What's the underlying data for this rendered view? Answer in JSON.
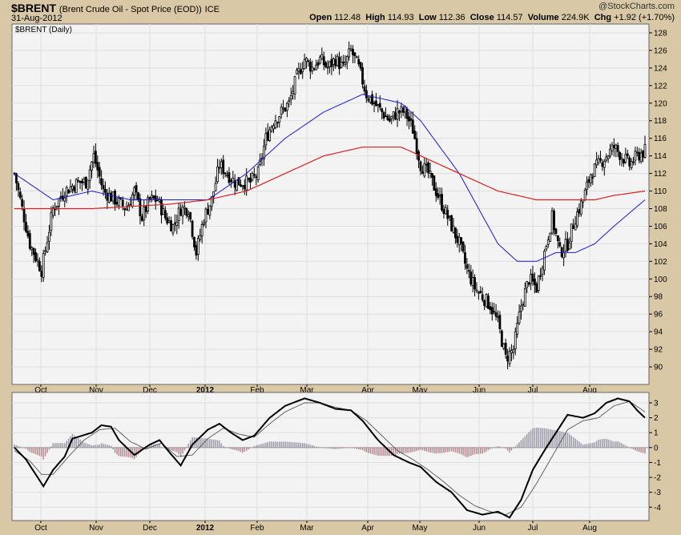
{
  "header": {
    "symbol": "$BRENT",
    "description": "(Brent Crude Oil - Spot Price (EOD))",
    "exchange": "ICE",
    "date": "31-Aug-2012",
    "watermark": "@StockCharts.com",
    "quote": {
      "open_label": "Open",
      "open": "112.48",
      "high_label": "High",
      "high": "114.93",
      "low_label": "Low",
      "low": "112.36",
      "close_label": "Close",
      "close": "114.57",
      "volume_label": "Volume",
      "volume": "224.9K",
      "chg_label": "Chg",
      "chg": "+1.92 (+1.70%)"
    }
  },
  "chart_data": [
    {
      "type": "candlestick",
      "legend": "$BRENT (Daily)",
      "ylim": [
        88,
        129
      ],
      "yticks": [
        90,
        92,
        94,
        96,
        98,
        100,
        102,
        104,
        106,
        108,
        110,
        112,
        114,
        116,
        118,
        120,
        122,
        124,
        126,
        128
      ],
      "grid": true,
      "x_labels": [
        "Oct",
        "Nov",
        "Dec",
        "2012",
        "Feb",
        "Mar",
        "Apr",
        "May",
        "Jun",
        "Jul",
        "Aug"
      ],
      "price_anchors": [
        [
          0,
          112
        ],
        [
          8,
          104
        ],
        [
          14,
          101
        ],
        [
          20,
          108
        ],
        [
          26,
          110
        ],
        [
          33,
          111
        ],
        [
          37,
          111
        ],
        [
          41,
          114
        ],
        [
          46,
          110
        ],
        [
          52,
          109
        ],
        [
          58,
          108
        ],
        [
          62,
          110
        ],
        [
          66,
          107
        ],
        [
          70,
          109
        ],
        [
          74,
          109
        ],
        [
          78,
          107
        ],
        [
          82,
          106
        ],
        [
          86,
          108
        ],
        [
          90,
          108
        ],
        [
          94,
          103
        ],
        [
          98,
          107
        ],
        [
          102,
          109
        ],
        [
          106,
          113
        ],
        [
          110,
          112
        ],
        [
          114,
          111
        ],
        [
          118,
          111
        ],
        [
          122,
          111
        ],
        [
          126,
          112
        ],
        [
          130,
          116
        ],
        [
          134,
          118
        ],
        [
          138,
          119
        ],
        [
          142,
          120
        ],
        [
          146,
          123
        ],
        [
          150,
          125
        ],
        [
          154,
          124
        ],
        [
          158,
          125
        ],
        [
          162,
          124
        ],
        [
          166,
          125
        ],
        [
          170,
          124
        ],
        [
          174,
          126
        ],
        [
          178,
          124
        ],
        [
          182,
          121
        ],
        [
          186,
          120
        ],
        [
          190,
          119
        ],
        [
          194,
          118
        ],
        [
          198,
          119
        ],
        [
          202,
          119
        ],
        [
          206,
          117
        ],
        [
          210,
          113
        ],
        [
          214,
          112
        ],
        [
          218,
          110
        ],
        [
          222,
          108
        ],
        [
          226,
          106
        ],
        [
          230,
          104
        ],
        [
          234,
          101
        ],
        [
          238,
          99
        ],
        [
          242,
          98
        ],
        [
          246,
          97
        ],
        [
          250,
          95
        ],
        [
          254,
          91
        ],
        [
          258,
          92
        ],
        [
          262,
          97
        ],
        [
          266,
          100
        ],
        [
          270,
          99
        ],
        [
          274,
          103
        ],
        [
          278,
          107
        ],
        [
          282,
          103
        ],
        [
          286,
          104
        ],
        [
          290,
          107
        ],
        [
          294,
          109
        ],
        [
          298,
          112
        ],
        [
          302,
          113
        ],
        [
          306,
          114
        ],
        [
          310,
          115
        ],
        [
          314,
          114
        ],
        [
          318,
          113
        ],
        [
          322,
          114
        ],
        [
          326,
          114.57
        ]
      ],
      "sma_50_anchors": [
        [
          0,
          112
        ],
        [
          20,
          109
        ],
        [
          40,
          110
        ],
        [
          60,
          109
        ],
        [
          80,
          109
        ],
        [
          100,
          109
        ],
        [
          120,
          112
        ],
        [
          140,
          116
        ],
        [
          160,
          119
        ],
        [
          180,
          121
        ],
        [
          200,
          120
        ],
        [
          210,
          118
        ],
        [
          220,
          115
        ],
        [
          230,
          112
        ],
        [
          240,
          108
        ],
        [
          250,
          104
        ],
        [
          260,
          102
        ],
        [
          270,
          102
        ],
        [
          280,
          103
        ],
        [
          290,
          103
        ],
        [
          300,
          104
        ],
        [
          310,
          106
        ],
        [
          326,
          109
        ]
      ],
      "sma_200_anchors": [
        [
          0,
          108
        ],
        [
          40,
          108
        ],
        [
          80,
          108.5
        ],
        [
          100,
          109
        ],
        [
          120,
          110
        ],
        [
          140,
          112
        ],
        [
          160,
          114
        ],
        [
          180,
          115
        ],
        [
          200,
          115
        ],
        [
          210,
          114
        ],
        [
          220,
          113
        ],
        [
          230,
          112
        ],
        [
          240,
          111
        ],
        [
          250,
          110
        ],
        [
          260,
          109.5
        ],
        [
          270,
          109
        ],
        [
          280,
          109
        ],
        [
          290,
          109
        ],
        [
          300,
          109
        ],
        [
          310,
          109.5
        ],
        [
          326,
          110
        ]
      ]
    },
    {
      "type": "macd",
      "ylim": [
        -4.9,
        3.7
      ],
      "yticks": [
        -4,
        -3,
        -2,
        -1,
        0,
        1,
        2,
        3
      ],
      "grid": true,
      "x_labels": [
        "Oct",
        "Nov",
        "Dec",
        "2012",
        "Feb",
        "Mar",
        "Apr",
        "May",
        "Jun",
        "Jul",
        "Aug"
      ],
      "macd_anchors": [
        [
          0,
          0
        ],
        [
          6,
          -0.8
        ],
        [
          12,
          -2
        ],
        [
          15,
          -2.6
        ],
        [
          20,
          -1.5
        ],
        [
          26,
          -0.6
        ],
        [
          30,
          0.6
        ],
        [
          40,
          1
        ],
        [
          45,
          1.5
        ],
        [
          50,
          1.4
        ],
        [
          54,
          0.5
        ],
        [
          58,
          0
        ],
        [
          62,
          -0.5
        ],
        [
          70,
          0.2
        ],
        [
          75,
          0.5
        ],
        [
          80,
          -0.3
        ],
        [
          86,
          -1.2
        ],
        [
          92,
          0.2
        ],
        [
          100,
          1.2
        ],
        [
          106,
          1.6
        ],
        [
          112,
          1
        ],
        [
          118,
          0.5
        ],
        [
          124,
          0.8
        ],
        [
          132,
          2
        ],
        [
          140,
          2.8
        ],
        [
          150,
          3.3
        ],
        [
          158,
          3.0
        ],
        [
          166,
          2.6
        ],
        [
          174,
          2.5
        ],
        [
          180,
          1.8
        ],
        [
          188,
          0.5
        ],
        [
          196,
          -0.5
        ],
        [
          204,
          -1.0
        ],
        [
          210,
          -1.3
        ],
        [
          218,
          -2.3
        ],
        [
          226,
          -3
        ],
        [
          234,
          -4.2
        ],
        [
          242,
          -4.5
        ],
        [
          250,
          -4.3
        ],
        [
          256,
          -4.7
        ],
        [
          262,
          -3.5
        ],
        [
          268,
          -1.5
        ],
        [
          274,
          -0.2
        ],
        [
          280,
          1
        ],
        [
          286,
          2.2
        ],
        [
          294,
          2
        ],
        [
          300,
          2.3
        ],
        [
          306,
          3
        ],
        [
          312,
          3.3
        ],
        [
          318,
          3.1
        ],
        [
          322,
          2.5
        ],
        [
          326,
          2
        ]
      ],
      "signal_anchors": [
        [
          0,
          -0.2
        ],
        [
          8,
          -0.9
        ],
        [
          14,
          -1.8
        ],
        [
          20,
          -1.8
        ],
        [
          28,
          -0.6
        ],
        [
          36,
          0.5
        ],
        [
          44,
          1.2
        ],
        [
          52,
          1.3
        ],
        [
          60,
          0.4
        ],
        [
          68,
          -0.1
        ],
        [
          76,
          0.3
        ],
        [
          84,
          -0.6
        ],
        [
          92,
          -0.5
        ],
        [
          100,
          0.6
        ],
        [
          108,
          1.3
        ],
        [
          116,
          0.9
        ],
        [
          124,
          0.7
        ],
        [
          132,
          1.6
        ],
        [
          140,
          2.4
        ],
        [
          150,
          3.0
        ],
        [
          158,
          3.0
        ],
        [
          166,
          2.7
        ],
        [
          174,
          2.5
        ],
        [
          182,
          1.8
        ],
        [
          190,
          0.8
        ],
        [
          198,
          -0.2
        ],
        [
          206,
          -0.8
        ],
        [
          214,
          -1.5
        ],
        [
          222,
          -2.3
        ],
        [
          230,
          -3.2
        ],
        [
          238,
          -3.9
        ],
        [
          246,
          -4.3
        ],
        [
          254,
          -4.5
        ],
        [
          262,
          -4.0
        ],
        [
          270,
          -2.4
        ],
        [
          278,
          -0.6
        ],
        [
          286,
          1.2
        ],
        [
          294,
          1.8
        ],
        [
          302,
          2.0
        ],
        [
          310,
          2.8
        ],
        [
          318,
          3.1
        ],
        [
          326,
          2.4
        ]
      ]
    }
  ],
  "colors": {
    "background": "#d9c8a5",
    "panel": "#f3f3f3",
    "grid": "#dedede",
    "candle": "#000000",
    "sma_short": "#1a1ad6",
    "sma_long": "#d62020",
    "hist_pos": "#9a9aa9",
    "hist_neg": "#b58a90",
    "signal": "#555555"
  }
}
